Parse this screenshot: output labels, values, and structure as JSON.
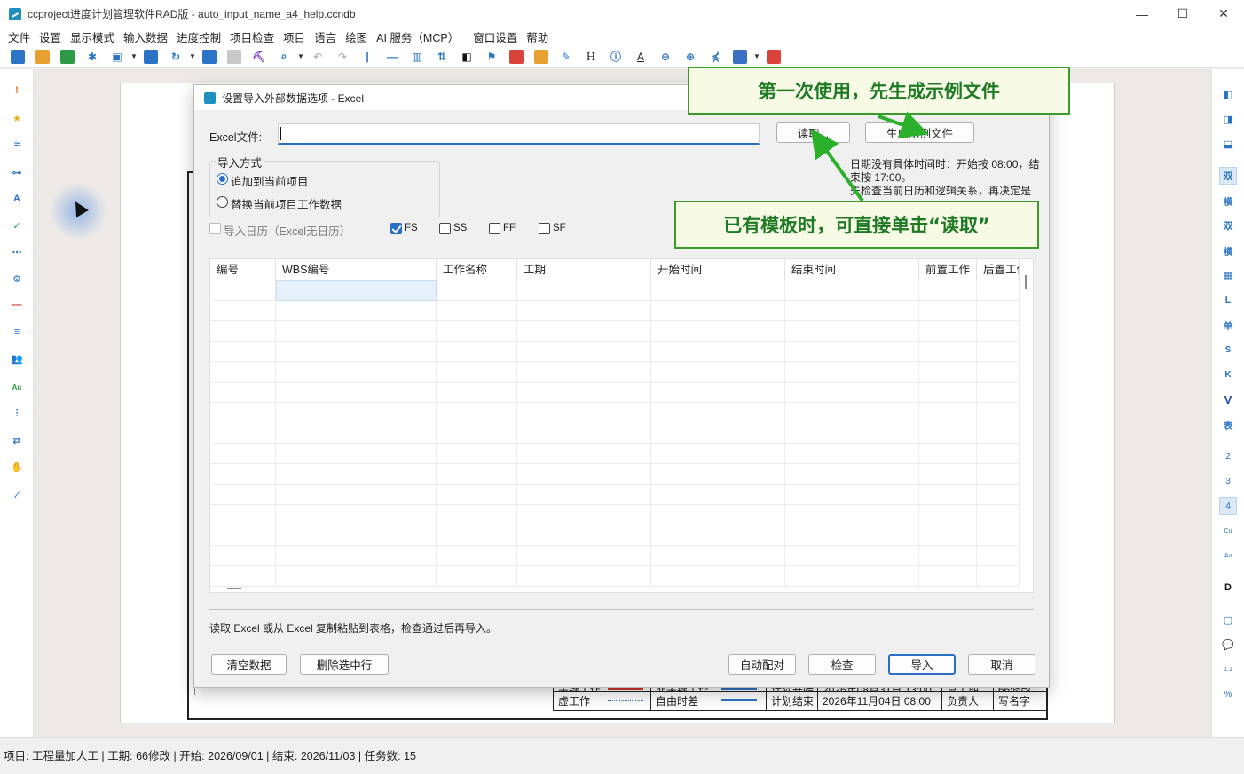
{
  "window": {
    "title": "ccproject进度计划管理软件RAD版 - auto_input_name_a4_help.ccndb",
    "controls": [
      "—",
      "☐",
      "✕"
    ]
  },
  "menu": [
    "文件",
    "设置",
    "显示模式",
    "输入数据",
    "进度控制",
    "项目检查",
    "项目",
    "语言",
    "绘图",
    "AI 服务（MCP）",
    "窗口设置",
    "帮助"
  ],
  "toolbar_glyphs": {
    "h": "H",
    "a": "A",
    "hook": "⋠"
  },
  "right_toolbar": [
    "双",
    "横",
    "双",
    "横",
    "L",
    "单",
    "S",
    "K",
    "V",
    "表",
    "2",
    "3",
    "4",
    "Cu",
    "Au",
    "D",
    "1.1",
    "%"
  ],
  "legend": {
    "row1": [
      "关键工作",
      "非关键工作",
      "计划开始",
      "2026年08月31日 13:00",
      "总工期",
      "66修改"
    ],
    "row2": [
      "虚工作",
      "自由时差",
      "计划结束",
      "2026年11月04日 08:00",
      "负责人",
      "写名字"
    ]
  },
  "statusbar": {
    "text": "项目: 工程量加人工 | 工期: 66修改 | 开始: 2026/09/01 | 结束: 2026/11/03 | 任务数: 15"
  },
  "dialog": {
    "title": "设置导入外部数据选项 - Excel",
    "excel_file_label": "Excel文件:",
    "excel_file_value": "",
    "read_button": "读取...",
    "generate_example_button": "生成示例文件",
    "import_mode_title": "导入方式",
    "radio_append": "追加到当前项目",
    "radio_replace": "替换当前项目工作数据",
    "import_calendar": "导入日历（Excel无日历）",
    "checkboxes": {
      "fs": "FS",
      "ss": "SS",
      "ff": "FF",
      "sf": "SF"
    },
    "info_text": "日期没有具体时间时：开始按 08:00，结束按 17:00。\n先检查当前日历和逻辑关系，再决定是否需要选择日历。",
    "columns": [
      "编号",
      "WBS编号",
      "工作名称",
      "工期",
      "开始时间",
      "结束时间",
      "前置工作",
      "后置工作"
    ],
    "hint": "读取 Excel 或从 Excel 复制粘贴到表格，检查通过后再导入。",
    "buttons": {
      "clear": "清空数据",
      "delete_selected": "删除选中行",
      "auto_match": "自动配对",
      "check": "检查",
      "import": "导入",
      "cancel": "取消"
    }
  },
  "callouts": {
    "first_use": "第一次使用，先生成示例文件",
    "has_template": "已有模板时，可直接单击“读取”"
  },
  "colors": {
    "accent": "#2a6ec8",
    "callout_border": "#3c9a2a",
    "callout_bg": "#f7fbe6",
    "callout_text": "#1f7a24"
  }
}
